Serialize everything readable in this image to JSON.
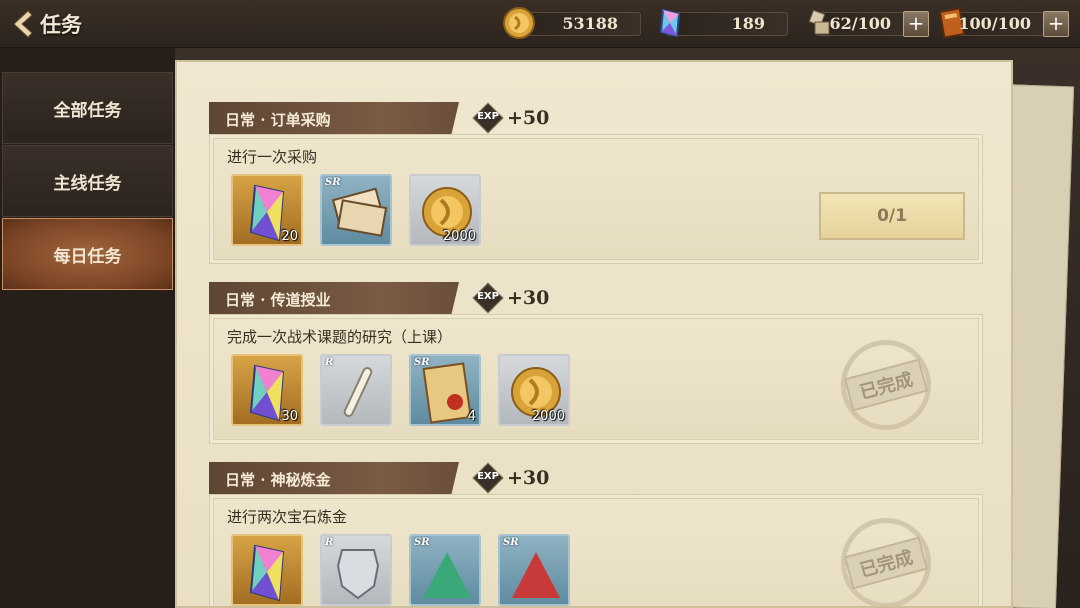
{
  "header": {
    "title": "任务"
  },
  "resources": [
    {
      "name": "gold",
      "value": "53188"
    },
    {
      "name": "gem",
      "value": "189"
    },
    {
      "name": "stamina",
      "value": "62/100"
    },
    {
      "name": "book",
      "value": "100/100"
    }
  ],
  "sidebar": {
    "items": [
      {
        "label": "全部任务"
      },
      {
        "label": "主线任务"
      },
      {
        "label": "每日任务",
        "active": true
      }
    ]
  },
  "quests": [
    {
      "title": "日常 · 订单采购",
      "exp": "+50",
      "desc": "进行一次采购",
      "rewards": [
        {
          "type": "gem",
          "count": "20"
        },
        {
          "type": "ticket",
          "rarity": "SR",
          "count": ""
        },
        {
          "type": "gold-coin",
          "count": "2000"
        }
      ],
      "progress": "0/1"
    },
    {
      "title": "日常 · 传道授业",
      "exp": "+30",
      "desc": "完成一次战术课题的研究（上课）",
      "rewards": [
        {
          "type": "gem",
          "count": "30"
        },
        {
          "type": "chalk",
          "rarity": "R",
          "count": ""
        },
        {
          "type": "scroll",
          "rarity": "SR",
          "count": "4"
        },
        {
          "type": "gold-coin",
          "count": "2000"
        }
      ],
      "status": "已完成"
    },
    {
      "title": "日常 · 神秘炼金",
      "exp": "+30",
      "desc": "进行两次宝石炼金",
      "rewards": [
        {
          "type": "gem",
          "count": ""
        },
        {
          "type": "badge",
          "rarity": "R",
          "count": ""
        },
        {
          "type": "green-powder",
          "rarity": "SR",
          "count": ""
        },
        {
          "type": "red-powder",
          "rarity": "SR",
          "count": ""
        }
      ],
      "status": "已完成"
    }
  ],
  "labels": {
    "exp": "EXP"
  },
  "colors": {
    "active_tab": "#7a4425",
    "panel": "#efe7cf",
    "quest_tab": "#6a4e3a"
  }
}
